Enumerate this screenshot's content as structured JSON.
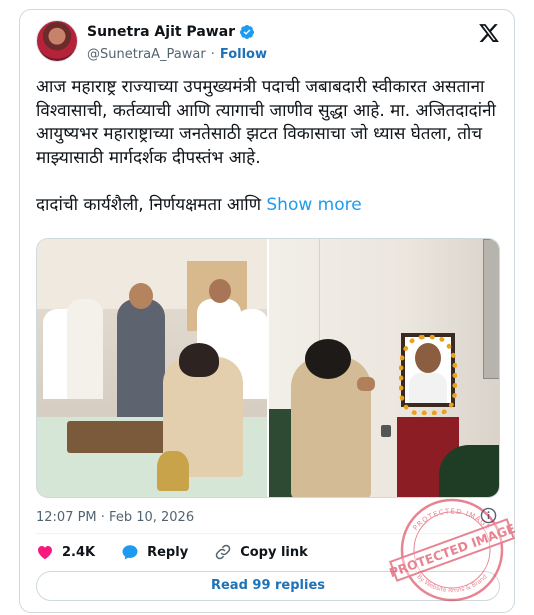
{
  "author": {
    "name": "Sunetra Ajit Pawar",
    "handle": "@SunetraA_Pawar",
    "separator": "·",
    "follow_label": "Follow",
    "verified_icon": "verified-badge-icon"
  },
  "tweet": {
    "text": "आज महाराष्ट्र राज्याच्या उपमुख्यमंत्री पदाची जबाबदारी स्वीकारत असताना विश्वासाची, कर्तव्याची आणि त्यागाची जाणीव सुद्धा आहे. मा. अजितदादांनी आयुष्यभर महाराष्ट्राच्या जनतेसाठी झटत विकासाचा जो ध्यास घेतला, तोच माझ्यासाठी मार्गदर्शक दीपस्तंभ आहे.\n\nदादांची कार्यशैली, निर्णयक्षमता आणि ",
    "show_more": "Show more"
  },
  "meta": {
    "timestamp": "12:07 PM · Feb 10, 2026"
  },
  "actions": {
    "likes": "2.4K",
    "reply_label": "Reply",
    "copy_link_label": "Copy link"
  },
  "read_replies": "Read 99 replies",
  "watermark": {
    "main": "PROTECTED IMAGE",
    "arc_top": "PROTECTED IMAGE",
    "arc_bottom": "By Website Rmns & Brand"
  },
  "colors": {
    "link": "#1d9bf0",
    "follow": "#1d72b8",
    "like": "#f91880",
    "stamp": "#d61f3a"
  }
}
